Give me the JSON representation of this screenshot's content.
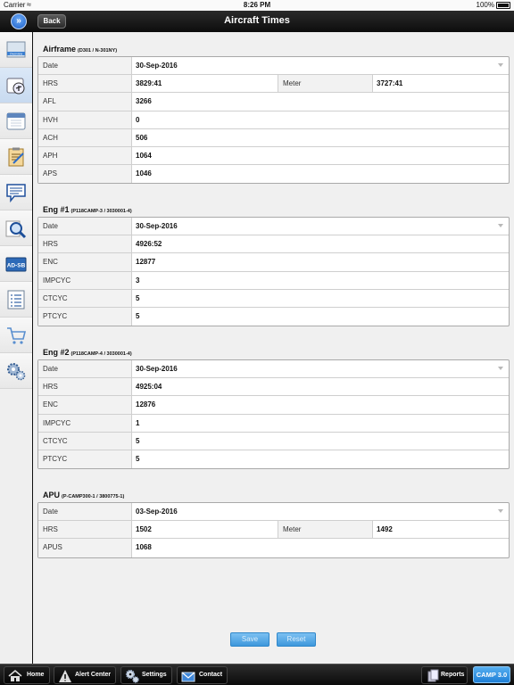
{
  "status_bar": {
    "carrier": "Carrier",
    "time": "8:26 PM",
    "battery": "100%"
  },
  "nav": {
    "title": "Aircraft Times",
    "back_label": "Back",
    "toggle_icon": "double-chevron-right-icon"
  },
  "sidebar": {
    "items": [
      {
        "icon": "overview-icon",
        "label": "Overview"
      },
      {
        "icon": "aircraft-times-icon"
      },
      {
        "icon": "calendar-icon"
      },
      {
        "icon": "checklist-icon"
      },
      {
        "icon": "messages-icon"
      },
      {
        "icon": "search-icon"
      },
      {
        "icon": "ad-sb-icon",
        "label": "AD-SB"
      },
      {
        "icon": "list-icon"
      },
      {
        "icon": "cart-icon"
      },
      {
        "icon": "settings-gears-icon"
      }
    ]
  },
  "sections": {
    "airframe": {
      "title": "Airframe",
      "subtitle": "(D301 / N-301NY)",
      "date_label": "Date",
      "date": "30-Sep-2016",
      "hrs_label": "HRS",
      "hrs": "3829:41",
      "meter_label": "Meter",
      "meter": "3727:41",
      "afl_label": "AFL",
      "afl": "3266",
      "hvh_label": "HVH",
      "hvh": "0",
      "ach_label": "ACH",
      "ach": "506",
      "aph_label": "APH",
      "aph": "1064",
      "aps_label": "APS",
      "aps": "1046"
    },
    "eng1": {
      "title": "Eng #1",
      "subtitle": "(P118CAMP-3 / 3030001-4)",
      "date_label": "Date",
      "date": "30-Sep-2016",
      "hrs_label": "HRS",
      "hrs": "4926:52",
      "enc_label": "ENC",
      "enc": "12877",
      "impcyc_label": "IMPCYC",
      "impcyc": "3",
      "ctcyc_label": "CTCYC",
      "ctcyc": "5",
      "ptcyc_label": "PTCYC",
      "ptcyc": "5"
    },
    "eng2": {
      "title": "Eng #2",
      "subtitle": "(P118CAMP-4 / 3030001-4)",
      "date_label": "Date",
      "date": "30-Sep-2016",
      "hrs_label": "HRS",
      "hrs": "4925:04",
      "enc_label": "ENC",
      "enc": "12876",
      "impcyc_label": "IMPCYC",
      "impcyc": "1",
      "ctcyc_label": "CTCYC",
      "ctcyc": "5",
      "ptcyc_label": "PTCYC",
      "ptcyc": "5"
    },
    "apu": {
      "title": "APU",
      "subtitle": "(P-CAMP300-1 / 3800775-1)",
      "date_label": "Date",
      "date": "03-Sep-2016",
      "hrs_label": "HRS",
      "hrs": "1502",
      "meter_label": "Meter",
      "meter": "1492",
      "apus_label": "APUS",
      "apus": "1068"
    }
  },
  "actions": {
    "save_label": "Save",
    "reset_label": "Reset"
  },
  "toolbar": {
    "home_label": "Home",
    "alert_label": "Alert Center",
    "settings_label": "Settings",
    "contact_label": "Contact",
    "reports_label": "Reports",
    "camp_label": "CAMP 3.0"
  },
  "colors": {
    "accent": "#3e98dc",
    "selected_sidebar": "#c8daf0",
    "nav_bar": "#111111"
  }
}
